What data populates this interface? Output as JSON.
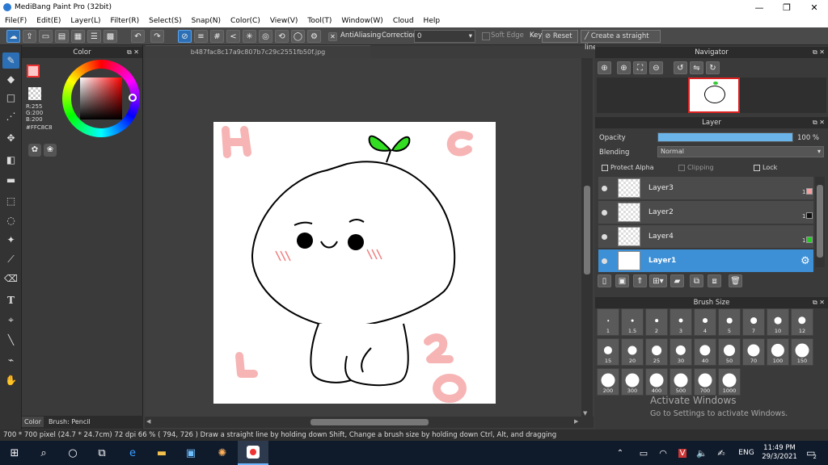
{
  "window": {
    "title": "MediBang Paint Pro (32bit)"
  },
  "menu": [
    "File(F)",
    "Edit(E)",
    "Layer(L)",
    "Filter(R)",
    "Select(S)",
    "Snap(N)",
    "Color(C)",
    "View(V)",
    "Tool(T)",
    "Window(W)",
    "Cloud",
    "Help"
  ],
  "toolbar": {
    "antialias_label": "AntiAliasing",
    "correction_label": "Correction",
    "correction_value": "0",
    "soft_edge_label": "Soft Edge",
    "key_label": "Key",
    "reset_label": "Reset",
    "straight_line_label": "Create a straight line"
  },
  "color_panel": {
    "title": "Color",
    "r": "R:255",
    "g": "G:200",
    "b": "B:200",
    "hex": "#FFC8C8",
    "tab_color": "Color",
    "tab_brush": "Brush: Pencil"
  },
  "document": {
    "tab": "b487fac8c17a9c807b7c29c2551fb50f.jpg"
  },
  "canvas_letters": {
    "h": "H",
    "c": "C",
    "l": "L",
    "n20": "20"
  },
  "navigator": {
    "title": "Navigator"
  },
  "layer_panel": {
    "title": "Layer",
    "opacity_label": "Opacity",
    "opacity_value": "100 %",
    "opacity_level": 1.0,
    "blending_label": "Blending",
    "blending_value": "Normal",
    "protect_alpha": "Protect Alpha",
    "clipping": "Clipping",
    "lock": "Lock",
    "layers": [
      {
        "name": "Layer3",
        "num": "1",
        "swatch": "#f4a0a0"
      },
      {
        "name": "Layer2",
        "num": "1",
        "swatch": "#111111"
      },
      {
        "name": "Layer4",
        "num": "1",
        "swatch": "#22cc22"
      },
      {
        "name": "Layer1",
        "num": "",
        "swatch": ""
      }
    ]
  },
  "brush_size": {
    "title": "Brush Size",
    "sizes": [
      "1",
      "1.5",
      "2",
      "3",
      "4",
      "5",
      "7",
      "10",
      "12",
      "15",
      "20",
      "25",
      "30",
      "40",
      "50",
      "70",
      "100",
      "150",
      "200",
      "300",
      "400",
      "500",
      "700",
      "1000"
    ]
  },
  "watermark": {
    "line1": "Activate Windows",
    "line2": "Go to Settings to activate Windows."
  },
  "status": {
    "text": "700 * 700 pixel   (24.7 * 24.7cm)   72 dpi   66 %   ( 794, 726 )   Draw a straight line by holding down Shift, Change a brush size by holding down Ctrl, Alt, and dragging"
  },
  "taskbar": {
    "lang": "ENG",
    "time": "11:49 PM",
    "date": "29/3/2021",
    "notif": "2"
  },
  "colors": {
    "accent": "#2c6fb5",
    "selected_layer": "#3d8fd6",
    "current_color": "#FFC8C8"
  }
}
